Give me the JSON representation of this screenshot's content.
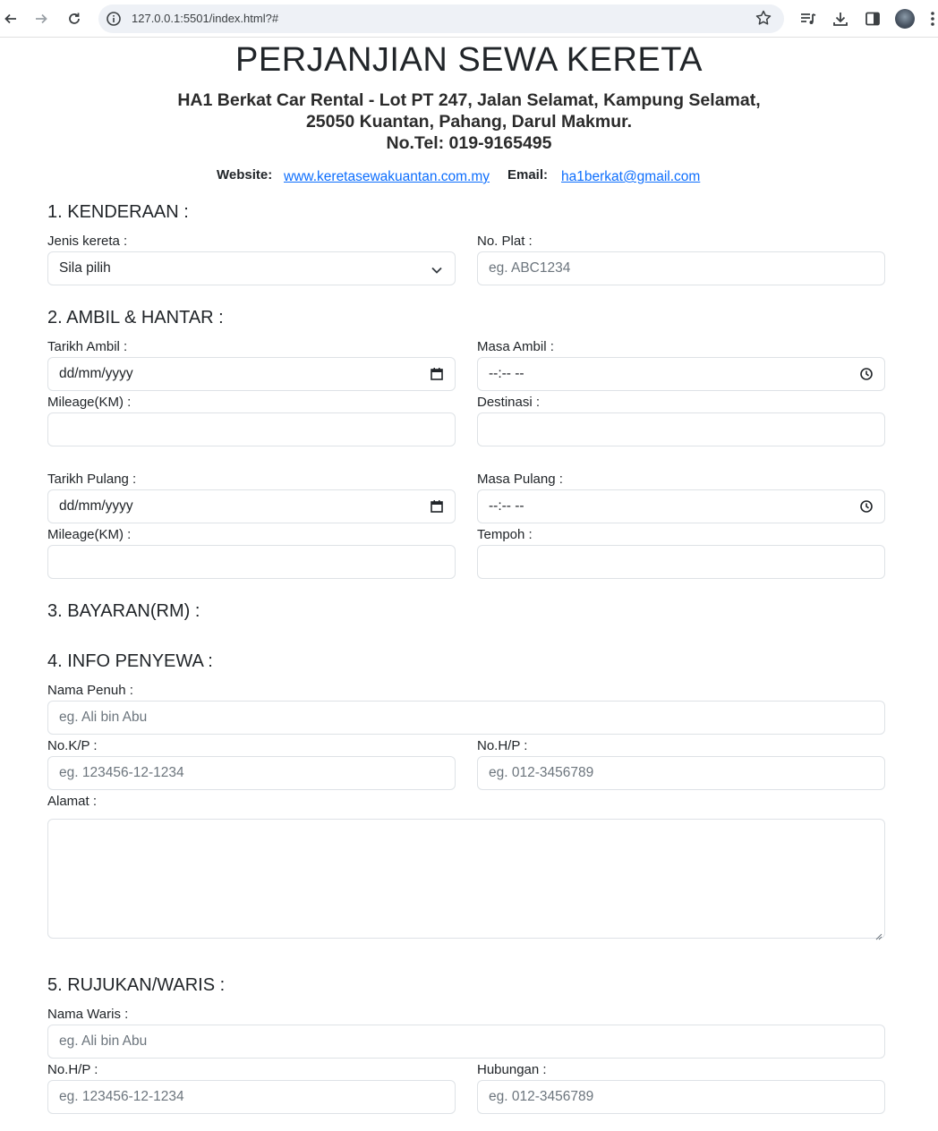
{
  "browser": {
    "url": "127.0.0.1:5501/index.html?#"
  },
  "header": {
    "title": "PERJANJIAN SEWA KERETA",
    "company_line_1": "HA1 Berkat Car Rental - Lot PT 247, Jalan Selamat, Kampung Selamat,",
    "company_line_2": "25050 Kuantan, Pahang, Darul Makmur.",
    "company_line_3": "No.Tel: 019-9165495",
    "website_label": "Website:",
    "website_link": "www.keretasewakuantan.com.my",
    "email_label": "Email:",
    "email_link": "ha1berkat@gmail.com"
  },
  "section1": {
    "title": "1. KENDERAAN :",
    "car_type_label": "Jenis kereta :",
    "car_type_selected": "Sila pilih",
    "plate_label": "No. Plat :",
    "plate_placeholder": "eg. ABC1234"
  },
  "section2": {
    "title": "2. AMBIL & HANTAR :",
    "pickup_date_label": "Tarikh Ambil :",
    "pickup_date_value": "dd/mm/yyyy",
    "pickup_time_label": "Masa Ambil :",
    "pickup_time_value": "--:-- --",
    "pickup_mileage_label": "Mileage(KM) :",
    "destination_label": "Destinasi :",
    "return_date_label": "Tarikh Pulang :",
    "return_date_value": "dd/mm/yyyy",
    "return_time_label": "Masa Pulang :",
    "return_time_value": "--:-- --",
    "return_mileage_label": "Mileage(KM) :",
    "duration_label": "Tempoh :"
  },
  "section3": {
    "title": "3. BAYARAN(RM) :"
  },
  "section4": {
    "title": "4. INFO PENYEWA :",
    "fullname_label": "Nama Penuh :",
    "fullname_placeholder": "eg. Ali bin Abu",
    "ic_label": "No.K/P :",
    "ic_placeholder": "eg. 123456-12-1234",
    "phone_label": "No.H/P :",
    "phone_placeholder": "eg. 012-3456789",
    "address_label": "Alamat :"
  },
  "section5": {
    "title": "5. RUJUKAN/WARIS :",
    "heir_name_label": "Nama Waris :",
    "heir_name_placeholder": "eg. Ali bin Abu",
    "heir_phone_label": "No.H/P :",
    "heir_phone_placeholder": "eg. 123456-12-1234",
    "relation_label": "Hubungan :",
    "relation_placeholder": "eg. 012-3456789"
  }
}
